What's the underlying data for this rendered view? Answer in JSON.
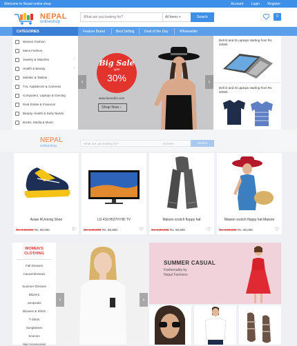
{
  "topbar": {
    "welcome": "Welcome to Nepal online shop",
    "account": "Account",
    "login": "Login",
    "register": "Register"
  },
  "header": {
    "logo_main": "NEPAL",
    "logo_sub": "onlineshop",
    "search_placeholder": "What are you looking for?",
    "category_select": "All items",
    "search_button": "Search",
    "cart_count": "0"
  },
  "nav": {
    "categories_label": "CATEGORIES",
    "items": [
      "Feature Brand",
      "Best Selling",
      "Deal of the Day",
      "Wholeseller"
    ]
  },
  "sidebar": {
    "items": [
      {
        "label": "Women Fashion",
        "icon": "women-icon"
      },
      {
        "label": "Mens Fashion",
        "icon": "men-icon"
      },
      {
        "label": "Jewelry & Watches",
        "icon": "jewelry-icon"
      },
      {
        "label": "Health & Beauty",
        "icon": "health-icon"
      },
      {
        "label": "Mobiles & Tablets",
        "icon": "mobile-icon"
      },
      {
        "label": "Tvs, Appliances & Cameras",
        "icon": "tv-icon"
      },
      {
        "label": "Computers, Laptops & Gaming",
        "icon": "computer-icon"
      },
      {
        "label": "Real Estate & Financial",
        "icon": "building-icon"
      },
      {
        "label": "Beauty, Health & Daily Needs",
        "icon": "beauty-icon"
      },
      {
        "label": "Books, Media & Music",
        "icon": "book-icon"
      }
    ]
  },
  "banner": {
    "title": "Big Sale",
    "upto": "upto",
    "discount": "30%",
    "url": "www.lucerdini.com",
    "shop_button": "Shop Now"
  },
  "promos": [
    {
      "title": "Dell i3 and i5 Laptops starting from Rs. 40000"
    },
    {
      "title": "Dell i3 and i5 Laptops starting from Rs. 40000"
    }
  ],
  "products": [
    {
      "name": "Asian RUnning Shoe",
      "old_price": "Rs. 1,00,900",
      "price": "Rs. 90,000"
    },
    {
      "name": "LG 43LH537H HD TV",
      "old_price": "Rs. 1,00,900",
      "price": "Rs. 90,000"
    },
    {
      "name": "Maison scotch floppy hat",
      "old_price": "Rs. 1,00,900",
      "price": "Rs. 90,000"
    },
    {
      "name": "Maison scotch floppy hat Maison",
      "old_price": "Rs. 1,00,900",
      "price": "Rs. 90,000"
    }
  ],
  "women": {
    "heading_line1": "WOMEN'S",
    "heading_line2": "CLOTHING",
    "items": [
      "Fall Dresses",
      "Casual Dresses",
      "Summer Dresses",
      "Blazers",
      "Jumpsuits",
      "Blouses & Shirts",
      "T-Shirts",
      "Sunglasses",
      "Scarves",
      "Hair Accessories"
    ]
  },
  "summer": {
    "title": "SUMMER CASUAL",
    "line1": "Fashionably by",
    "line2": "Nepal Fashions"
  },
  "colors": {
    "primary": "#3d8fe8",
    "accent": "#e2332c",
    "logo_orange": "#ef7d3a"
  }
}
